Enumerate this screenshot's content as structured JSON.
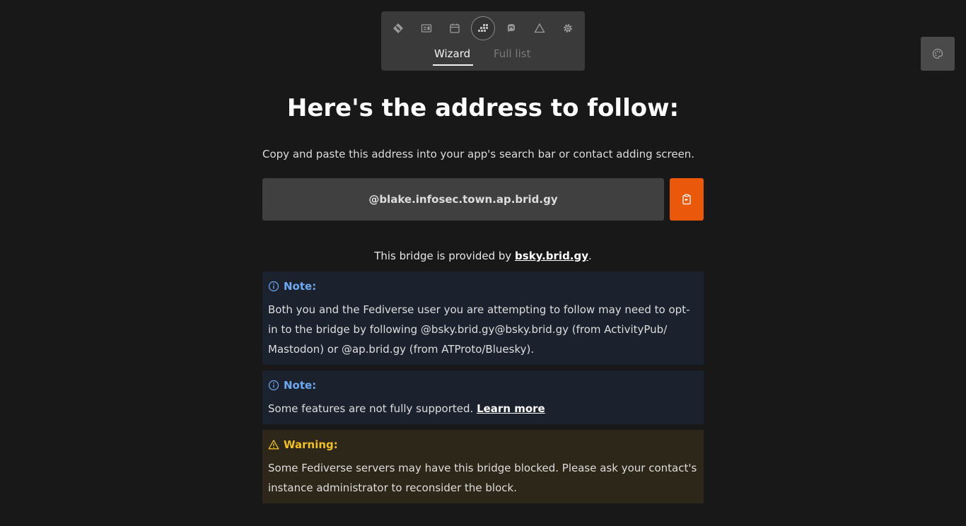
{
  "toolbar": {
    "icons": [
      "git-icon",
      "card-icon",
      "calendar-icon",
      "grid-icon",
      "mastodon-icon",
      "triangle-icon",
      "gear-icon"
    ],
    "tabs": [
      {
        "label": "Wizard",
        "active": true
      },
      {
        "label": "Full list",
        "active": false
      }
    ]
  },
  "palette_icon": "palette-icon",
  "main": {
    "heading": "Here's the address to follow:",
    "instructions": "Copy and paste this address into your app's search bar or contact adding screen.",
    "address": "@blake.infosec.town.ap.brid.gy",
    "copy_icon": "clipboard-icon",
    "provided_prefix": "This bridge is provided by ",
    "provided_link": "bsky.brid.gy",
    "provided_suffix": "."
  },
  "callouts": [
    {
      "type": "note",
      "title": "Note:",
      "body": "Both you and the Fediverse user you are attempting to follow may need to opt-in to the bridge by following @bsky.brid.gy@bsky.brid.gy (from ActivityPub/ Mastodon) or @ap.brid.gy (from ATProto/Bluesky)."
    },
    {
      "type": "note",
      "title": "Note:",
      "body": "Some features are not fully supported. ",
      "link": "Learn more"
    },
    {
      "type": "warning",
      "title": "Warning:",
      "body": "Some Fediverse servers may have this bridge blocked. Please ask your contact's instance administrator to reconsider the block."
    }
  ],
  "colors": {
    "background": "#181818",
    "accent": "#ea580c",
    "note": "#6ea8f0",
    "warning": "#f0bf2a"
  }
}
